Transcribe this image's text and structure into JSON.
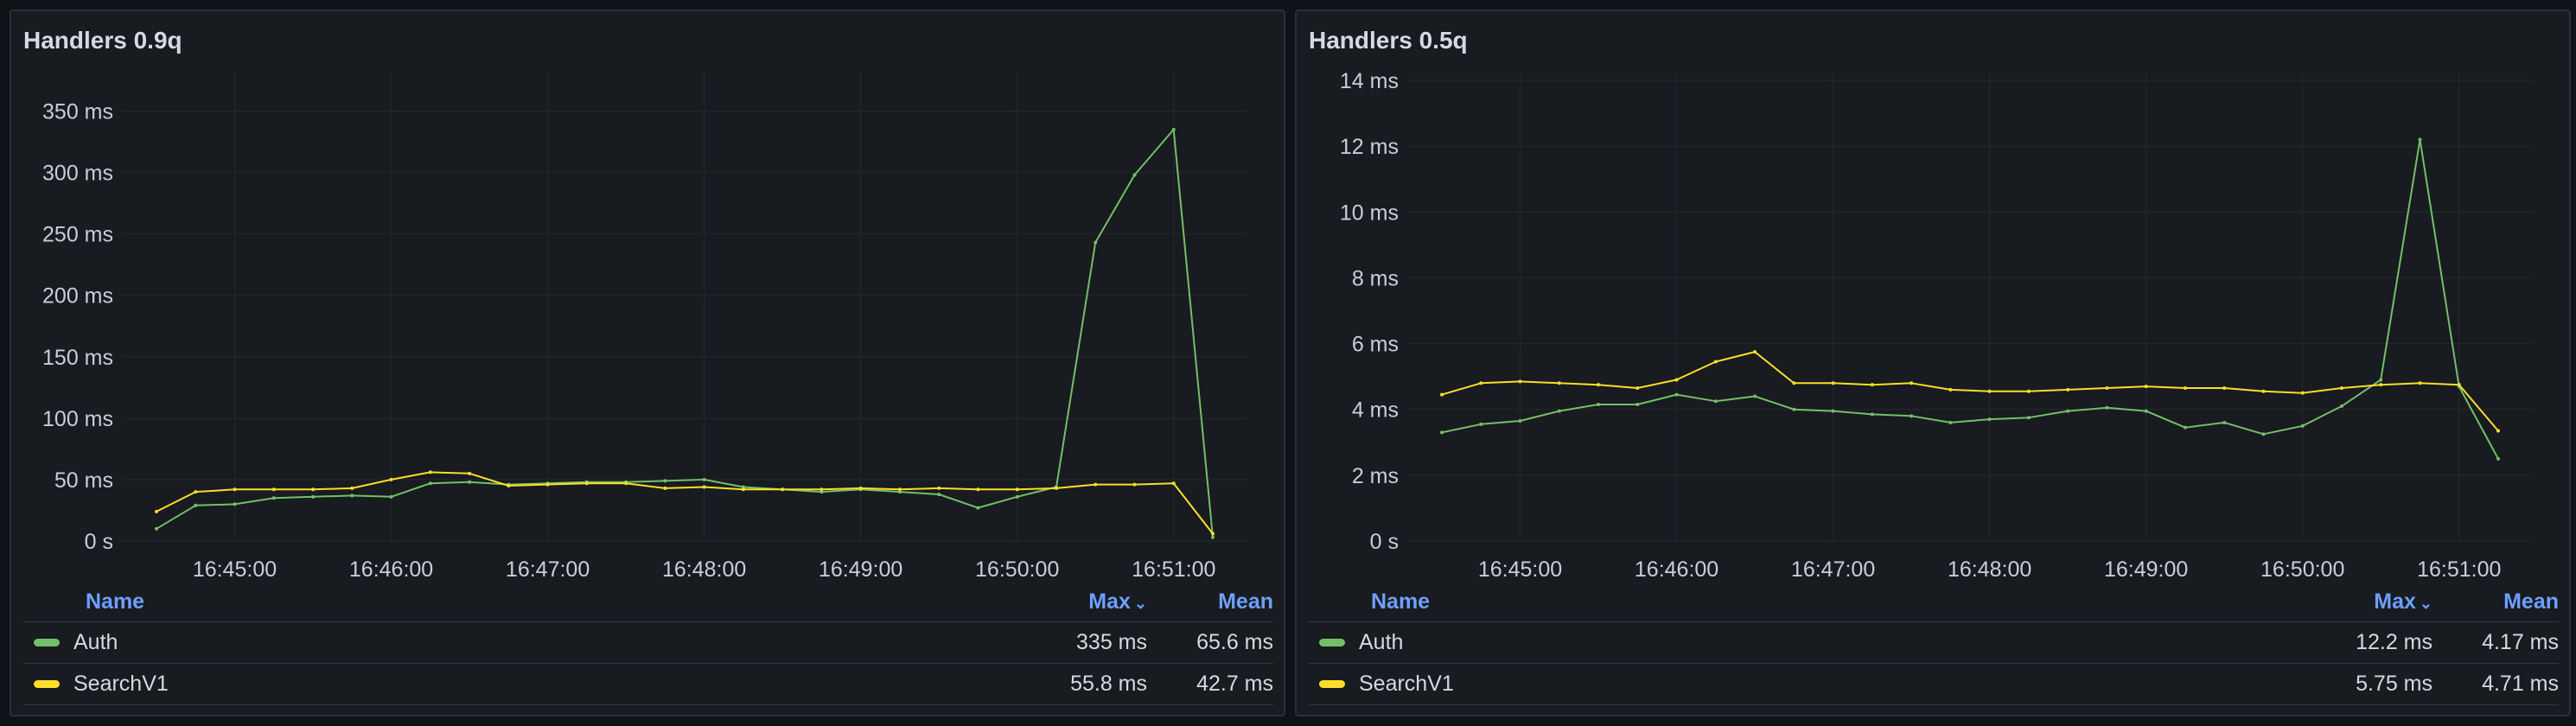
{
  "panels": [
    {
      "title": "Handlers 0.9q",
      "legend": {
        "col_name": "Name",
        "col_max": "Max",
        "col_mean": "Mean",
        "sort_icon": "chevron-down-icon",
        "rows": [
          {
            "name": "Auth",
            "max": "335 ms",
            "mean": "65.6 ms",
            "color": "#73bf69"
          },
          {
            "name": "SearchV1",
            "max": "55.8 ms",
            "mean": "42.7 ms",
            "color": "#fade2a"
          }
        ]
      }
    },
    {
      "title": "Handlers 0.5q",
      "legend": {
        "col_name": "Name",
        "col_max": "Max",
        "col_mean": "Mean",
        "sort_icon": "chevron-down-icon",
        "rows": [
          {
            "name": "Auth",
            "max": "12.2 ms",
            "mean": "4.17 ms",
            "color": "#73bf69"
          },
          {
            "name": "SearchV1",
            "max": "5.75 ms",
            "mean": "4.71 ms",
            "color": "#fade2a"
          }
        ]
      }
    }
  ],
  "chart_data": [
    {
      "type": "line",
      "title": "Handlers 0.9q",
      "x": [
        "16:44:30",
        "16:44:45",
        "16:45:00",
        "16:45:15",
        "16:45:30",
        "16:45:45",
        "16:46:00",
        "16:46:15",
        "16:46:30",
        "16:46:45",
        "16:47:00",
        "16:47:15",
        "16:47:30",
        "16:47:45",
        "16:48:00",
        "16:48:15",
        "16:48:30",
        "16:48:45",
        "16:49:00",
        "16:49:15",
        "16:49:30",
        "16:49:45",
        "16:50:00",
        "16:50:15",
        "16:50:30",
        "16:50:45",
        "16:51:00",
        "16:51:15"
      ],
      "x_ticks": [
        "16:45:00",
        "16:46:00",
        "16:47:00",
        "16:48:00",
        "16:49:00",
        "16:50:00",
        "16:51:00"
      ],
      "y_ticks": [
        "0 s",
        "50 ms",
        "100 ms",
        "150 ms",
        "200 ms",
        "250 ms",
        "300 ms",
        "350 ms"
      ],
      "ylim": [
        0,
        375
      ],
      "unit": "ms",
      "grid": true,
      "series": [
        {
          "name": "Auth",
          "color": "#73bf69",
          "values": [
            10,
            29,
            30,
            35,
            36,
            37,
            36,
            47,
            48,
            46,
            47,
            48,
            48,
            49,
            50,
            44,
            42,
            40,
            42,
            40,
            38,
            27,
            36,
            44,
            243,
            298,
            335,
            3
          ]
        },
        {
          "name": "SearchV1",
          "color": "#fade2a",
          "values": [
            24,
            40,
            42,
            42,
            42,
            43,
            50,
            56,
            55,
            45,
            46,
            47,
            47,
            43,
            44,
            42,
            42,
            42,
            43,
            42,
            43,
            42,
            42,
            43,
            46,
            46,
            47,
            6
          ]
        }
      ]
    },
    {
      "type": "line",
      "title": "Handlers 0.5q",
      "x": [
        "16:44:30",
        "16:44:45",
        "16:45:00",
        "16:45:15",
        "16:45:30",
        "16:45:45",
        "16:46:00",
        "16:46:15",
        "16:46:30",
        "16:46:45",
        "16:47:00",
        "16:47:15",
        "16:47:30",
        "16:47:45",
        "16:48:00",
        "16:48:15",
        "16:48:30",
        "16:48:45",
        "16:49:00",
        "16:49:15",
        "16:49:30",
        "16:49:45",
        "16:50:00",
        "16:50:15",
        "16:50:30",
        "16:50:45",
        "16:51:00",
        "16:51:15"
      ],
      "x_ticks": [
        "16:45:00",
        "16:46:00",
        "16:47:00",
        "16:48:00",
        "16:49:00",
        "16:50:00",
        "16:51:00"
      ],
      "y_ticks": [
        "0 s",
        "2 ms",
        "4 ms",
        "6 ms",
        "8 ms",
        "10 ms",
        "12 ms",
        "14 ms"
      ],
      "ylim": [
        0,
        14
      ],
      "unit": "ms",
      "grid": true,
      "series": [
        {
          "name": "Auth",
          "color": "#73bf69",
          "values": [
            3.3,
            3.55,
            3.65,
            3.95,
            4.15,
            4.15,
            4.45,
            4.25,
            4.4,
            4.0,
            3.95,
            3.85,
            3.8,
            3.6,
            3.7,
            3.75,
            3.95,
            4.05,
            3.95,
            3.45,
            3.6,
            3.25,
            3.5,
            4.1,
            4.9,
            12.2,
            4.7,
            2.5
          ]
        },
        {
          "name": "SearchV1",
          "color": "#fade2a",
          "values": [
            4.45,
            4.8,
            4.85,
            4.8,
            4.75,
            4.65,
            4.9,
            5.45,
            5.75,
            4.8,
            4.8,
            4.75,
            4.8,
            4.6,
            4.55,
            4.55,
            4.6,
            4.65,
            4.7,
            4.65,
            4.65,
            4.55,
            4.5,
            4.65,
            4.75,
            4.8,
            4.75,
            3.35
          ]
        }
      ]
    }
  ]
}
